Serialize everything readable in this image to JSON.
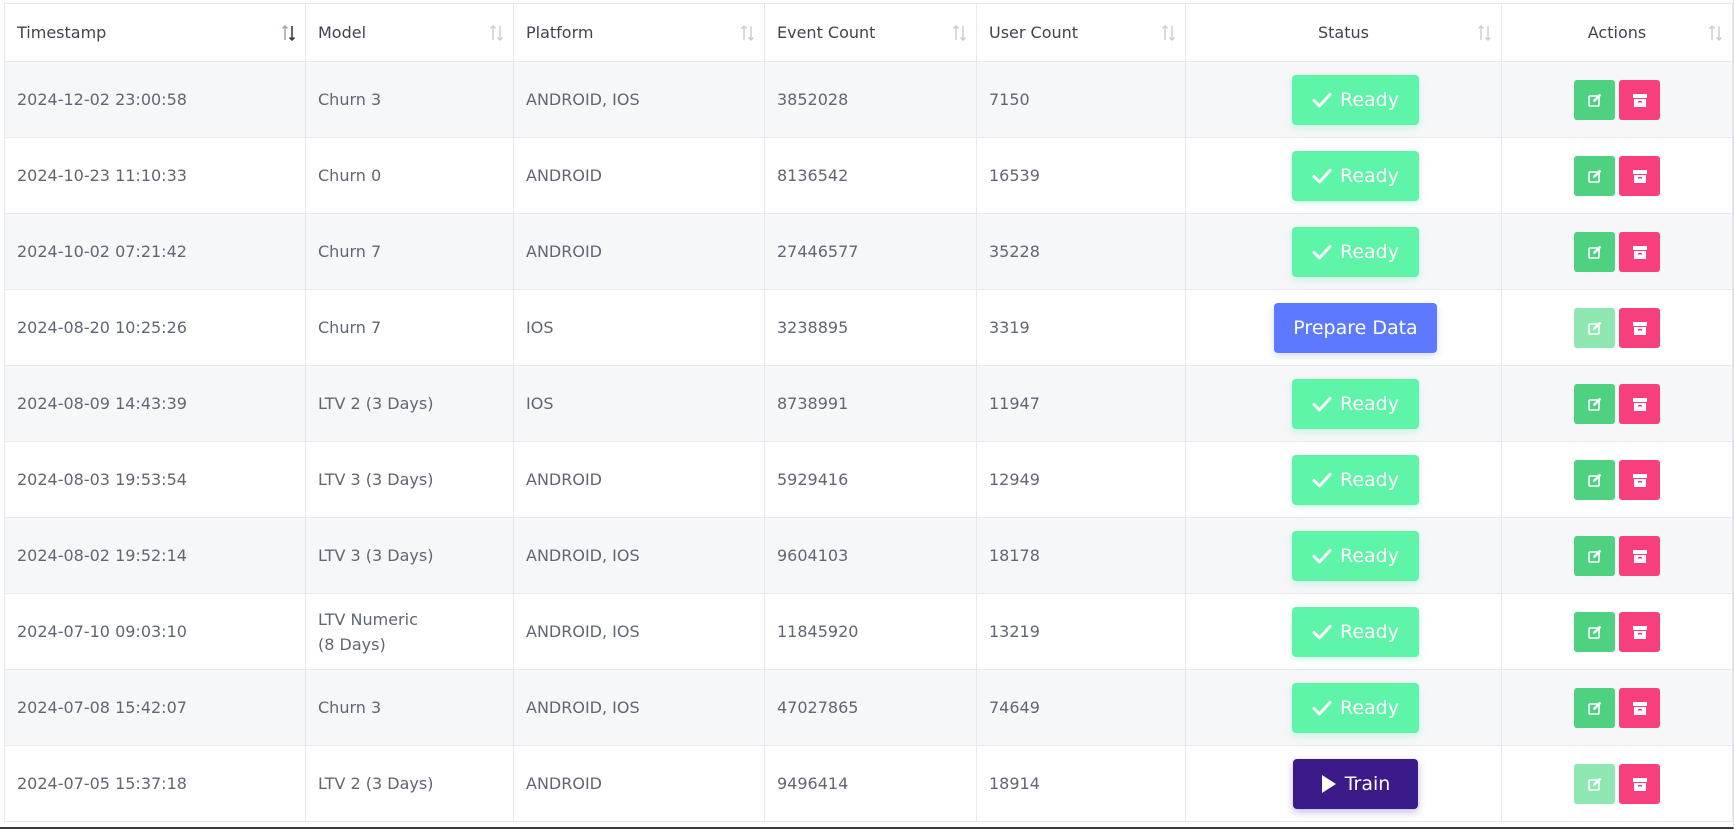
{
  "columns": {
    "timestamp": "Timestamp",
    "model": "Model",
    "platform": "Platform",
    "event_count": "Event Count",
    "user_count": "User Count",
    "status": "Status",
    "actions": "Actions"
  },
  "status_labels": {
    "ready": "Ready",
    "prepare": "Prepare Data",
    "train": "Train"
  },
  "colors": {
    "ready": "#5ff5a9",
    "prepare": "#5c79ff",
    "train": "#3b1a8a",
    "edit": "#4ed180",
    "archive": "#f73f7d"
  },
  "rows": [
    {
      "timestamp": "2024-12-02 23:00:58",
      "model": "Churn 3",
      "platform": "ANDROID, IOS",
      "event_count": "3852028",
      "user_count": "7150",
      "status": "ready",
      "edit_enabled": true
    },
    {
      "timestamp": "2024-10-23 11:10:33",
      "model": "Churn 0",
      "platform": "ANDROID",
      "event_count": "8136542",
      "user_count": "16539",
      "status": "ready",
      "edit_enabled": true
    },
    {
      "timestamp": "2024-10-02 07:21:42",
      "model": "Churn 7",
      "platform": "ANDROID",
      "event_count": "27446577",
      "user_count": "35228",
      "status": "ready",
      "edit_enabled": true
    },
    {
      "timestamp": "2024-08-20 10:25:26",
      "model": "Churn 7",
      "platform": "IOS",
      "event_count": "3238895",
      "user_count": "3319",
      "status": "prepare",
      "edit_enabled": false
    },
    {
      "timestamp": "2024-08-09 14:43:39",
      "model": "LTV 2 (3 Days)",
      "platform": "IOS",
      "event_count": "8738991",
      "user_count": "11947",
      "status": "ready",
      "edit_enabled": true
    },
    {
      "timestamp": "2024-08-03 19:53:54",
      "model": "LTV 3 (3 Days)",
      "platform": "ANDROID",
      "event_count": "5929416",
      "user_count": "12949",
      "status": "ready",
      "edit_enabled": true
    },
    {
      "timestamp": "2024-08-02 19:52:14",
      "model": "LTV 3 (3 Days)",
      "platform": "ANDROID, IOS",
      "event_count": "9604103",
      "user_count": "18178",
      "status": "ready",
      "edit_enabled": true
    },
    {
      "timestamp": "2024-07-10 09:03:10",
      "model": "LTV Numeric (8 Days)",
      "model_lines": [
        "LTV Numeric",
        "(8 Days)"
      ],
      "platform": "ANDROID, IOS",
      "event_count": "11845920",
      "user_count": "13219",
      "status": "ready",
      "edit_enabled": true
    },
    {
      "timestamp": "2024-07-08 15:42:07",
      "model": "Churn 3",
      "platform": "ANDROID, IOS",
      "event_count": "47027865",
      "user_count": "74649",
      "status": "ready",
      "edit_enabled": true
    },
    {
      "timestamp": "2024-07-05 15:37:18",
      "model": "LTV 2 (3 Days)",
      "platform": "ANDROID",
      "event_count": "9496414",
      "user_count": "18914",
      "status": "train",
      "edit_enabled": false
    }
  ]
}
